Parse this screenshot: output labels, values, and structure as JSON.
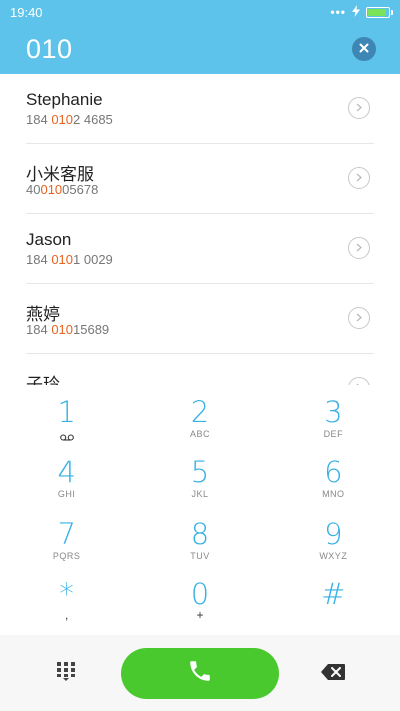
{
  "status_bar": {
    "time": "19:40",
    "indicators": "•••",
    "charging_icon": "bolt-icon",
    "battery_level": 0.92,
    "battery_color": "#7be35a"
  },
  "header": {
    "dialed_number": "010",
    "clear_icon": "close-circle-icon",
    "background": "#5ec3ea"
  },
  "contacts": [
    {
      "name": "Stephanie",
      "number_before": "184 ",
      "number_match": "010",
      "number_after": "2 4685"
    },
    {
      "name": "小米客服",
      "number_before": "40",
      "number_match": "010",
      "number_after": "05678"
    },
    {
      "name": "Jason",
      "number_before": "184 ",
      "number_match": "010",
      "number_after": "1 0029"
    },
    {
      "name": "燕婷",
      "number_before": "184 ",
      "number_match": "010",
      "number_after": "15689"
    },
    {
      "name": "子玲",
      "number_before": "",
      "number_match": "",
      "number_after": ""
    }
  ],
  "highlight_color": "#e8621d",
  "keypad": [
    {
      "digit": "1",
      "letters": "",
      "icon": "voicemail-icon"
    },
    {
      "digit": "2",
      "letters": "ABC"
    },
    {
      "digit": "3",
      "letters": "DEF"
    },
    {
      "digit": "4",
      "letters": "GHI"
    },
    {
      "digit": "5",
      "letters": "JKL"
    },
    {
      "digit": "6",
      "letters": "MNO"
    },
    {
      "digit": "7",
      "letters": "PQRS"
    },
    {
      "digit": "8",
      "letters": "TUV"
    },
    {
      "digit": "9",
      "letters": "WXYZ"
    },
    {
      "digit": "*",
      "letters": ","
    },
    {
      "digit": "0",
      "letters": "+"
    },
    {
      "digit": "#",
      "letters": ""
    }
  ],
  "keypad_digit_color": "#35b1e3",
  "bottom_bar": {
    "dialpad_icon": "dialpad-grid-icon",
    "call_icon": "phone-icon",
    "call_color": "#4ac92e",
    "backspace_icon": "backspace-icon"
  }
}
